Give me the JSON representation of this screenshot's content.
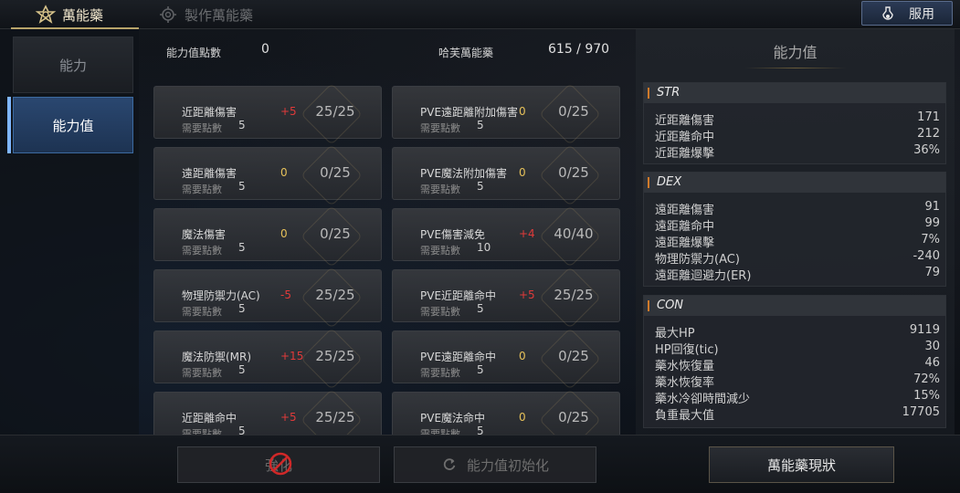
{
  "tabs": {
    "active": "萬能藥",
    "inactive": "製作萬能藥"
  },
  "use_button": "服用",
  "sidebar": {
    "items": [
      {
        "label": "能力"
      },
      {
        "label": "能力值"
      }
    ]
  },
  "header": {
    "points_label": "能力值點數",
    "points_value": "0",
    "elixir_label": "哈芙萬能藥",
    "elixir_value": "615 / 970"
  },
  "cards": [
    {
      "name": "近距離傷害",
      "need_label": "需要點數",
      "need": "5",
      "bonus": "+5",
      "bonus_color": "red",
      "progress": "25/25"
    },
    {
      "name": "PVE遠距離附加傷害",
      "need_label": "需要點數",
      "need": "5",
      "bonus": "0",
      "bonus_color": "yellow",
      "progress": "0/25"
    },
    {
      "name": "遠距離傷害",
      "need_label": "需要點數",
      "need": "5",
      "bonus": "0",
      "bonus_color": "yellow",
      "progress": "0/25"
    },
    {
      "name": "PVE魔法附加傷害",
      "need_label": "需要點數",
      "need": "5",
      "bonus": "0",
      "bonus_color": "yellow",
      "progress": "0/25"
    },
    {
      "name": "魔法傷害",
      "need_label": "需要點數",
      "need": "5",
      "bonus": "0",
      "bonus_color": "yellow",
      "progress": "0/25"
    },
    {
      "name": "PVE傷害減免",
      "need_label": "需要點數",
      "need": "10",
      "bonus": "+4",
      "bonus_color": "red",
      "progress": "40/40"
    },
    {
      "name": "物理防禦力(AC)",
      "need_label": "需要點數",
      "need": "5",
      "bonus": "-5",
      "bonus_color": "red",
      "progress": "25/25"
    },
    {
      "name": "PVE近距離命中",
      "need_label": "需要點數",
      "need": "5",
      "bonus": "+5",
      "bonus_color": "red",
      "progress": "25/25"
    },
    {
      "name": "魔法防禦(MR)",
      "need_label": "需要點數",
      "need": "5",
      "bonus": "+15",
      "bonus_color": "red",
      "progress": "25/25"
    },
    {
      "name": "PVE遠距離命中",
      "need_label": "需要點數",
      "need": "5",
      "bonus": "0",
      "bonus_color": "yellow",
      "progress": "0/25"
    },
    {
      "name": "近距離命中",
      "need_label": "需要點數",
      "need": "5",
      "bonus": "+5",
      "bonus_color": "red",
      "progress": "25/25"
    },
    {
      "name": "PVE魔法命中",
      "need_label": "需要點數",
      "need": "5",
      "bonus": "0",
      "bonus_color": "yellow",
      "progress": "0/25"
    }
  ],
  "stats_panel": {
    "title": "能力值",
    "str": {
      "title": "STR",
      "rows": [
        {
          "label": "近距離傷害",
          "value": "171"
        },
        {
          "label": "近距離命中",
          "value": "212"
        },
        {
          "label": "近距離爆擊",
          "value": "36%"
        }
      ]
    },
    "dex": {
      "title": "DEX",
      "rows": [
        {
          "label": "遠距離傷害",
          "value": "91"
        },
        {
          "label": "遠距離命中",
          "value": "99"
        },
        {
          "label": "遠距離爆擊",
          "value": "7%"
        },
        {
          "label": "物理防禦力(AC)",
          "value": "-240"
        },
        {
          "label": "遠距離迴避力(ER)",
          "value": "79"
        }
      ]
    },
    "con": {
      "title": "CON",
      "rows": [
        {
          "label": "最大HP",
          "value": "9119"
        },
        {
          "label": "HP回復(tic)",
          "value": "30"
        },
        {
          "label": "藥水恢復量",
          "value": "46"
        },
        {
          "label": "藥水恢復率",
          "value": "72%"
        },
        {
          "label": "藥水冷卻時間減少",
          "value": "15%"
        },
        {
          "label": "負重最大值",
          "value": "17705"
        }
      ]
    }
  },
  "bottom": {
    "reinforce": "強化",
    "reset": "能力值初始化",
    "status": "萬能藥現狀"
  }
}
